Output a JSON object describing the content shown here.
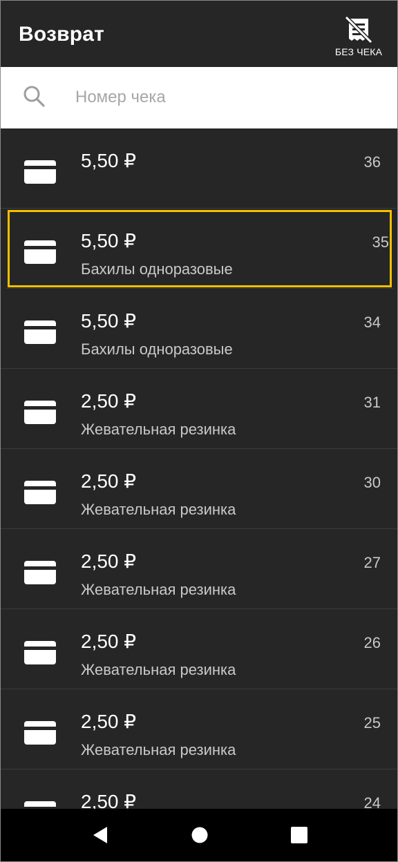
{
  "header": {
    "title": "Возврат",
    "no_receipt_label": "БЕЗ ЧЕКА",
    "no_receipt_icon": "receipt-crossed-icon"
  },
  "search": {
    "placeholder": "Номер чека",
    "value": "",
    "icon": "search-icon"
  },
  "receipts": [
    {
      "amount": "5,50 ₽",
      "name": "",
      "number": "36",
      "icon": "card-icon",
      "selected": false
    },
    {
      "amount": "5,50 ₽",
      "name": "Бахилы одноразовые",
      "number": "35",
      "icon": "card-icon",
      "selected": true
    },
    {
      "amount": "5,50 ₽",
      "name": "Бахилы одноразовые",
      "number": "34",
      "icon": "card-icon",
      "selected": false
    },
    {
      "amount": "2,50 ₽",
      "name": "Жевательная резинка",
      "number": "31",
      "icon": "card-icon",
      "selected": false
    },
    {
      "amount": "2,50 ₽",
      "name": "Жевательная резинка",
      "number": "30",
      "icon": "card-icon",
      "selected": false
    },
    {
      "amount": "2,50 ₽",
      "name": "Жевательная резинка",
      "number": "27",
      "icon": "card-icon",
      "selected": false
    },
    {
      "amount": "2,50 ₽",
      "name": "Жевательная резинка",
      "number": "26",
      "icon": "card-icon",
      "selected": false
    },
    {
      "amount": "2,50 ₽",
      "name": "Жевательная резинка",
      "number": "25",
      "icon": "card-icon",
      "selected": false
    },
    {
      "amount": "2,50 ₽",
      "name": "",
      "number": "24",
      "icon": "card-icon",
      "selected": false
    }
  ],
  "navbar": {
    "back_icon": "back-triangle-icon",
    "home_icon": "home-circle-icon",
    "recent_icon": "recents-square-icon"
  },
  "colors": {
    "background": "#262626",
    "highlight": "#f6c000",
    "text_primary": "#ffffff",
    "text_secondary": "#c9c9c9"
  }
}
